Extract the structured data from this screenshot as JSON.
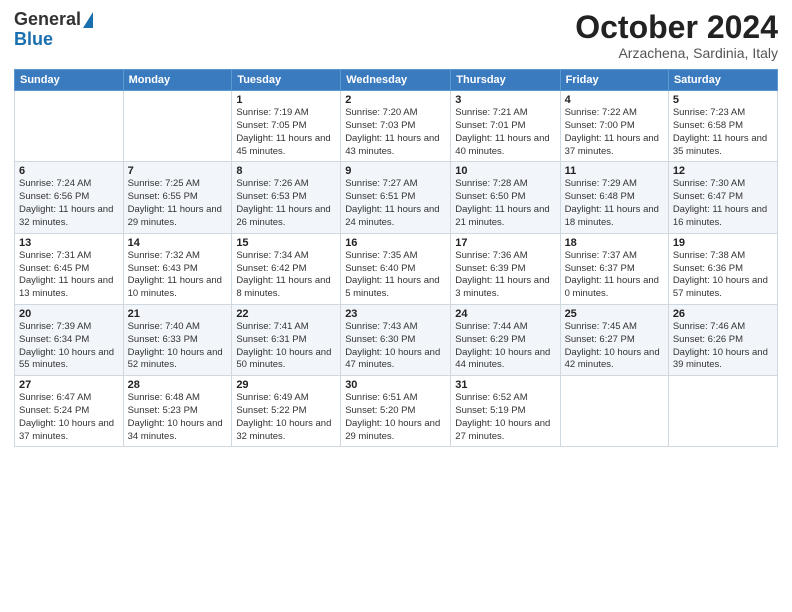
{
  "logo": {
    "line1": "General",
    "line2": "Blue"
  },
  "header": {
    "title": "October 2024",
    "subtitle": "Arzachena, Sardinia, Italy"
  },
  "weekdays": [
    "Sunday",
    "Monday",
    "Tuesday",
    "Wednesday",
    "Thursday",
    "Friday",
    "Saturday"
  ],
  "weeks": [
    [
      {
        "day": "",
        "info": ""
      },
      {
        "day": "",
        "info": ""
      },
      {
        "day": "1",
        "info": "Sunrise: 7:19 AM\nSunset: 7:05 PM\nDaylight: 11 hours and 45 minutes."
      },
      {
        "day": "2",
        "info": "Sunrise: 7:20 AM\nSunset: 7:03 PM\nDaylight: 11 hours and 43 minutes."
      },
      {
        "day": "3",
        "info": "Sunrise: 7:21 AM\nSunset: 7:01 PM\nDaylight: 11 hours and 40 minutes."
      },
      {
        "day": "4",
        "info": "Sunrise: 7:22 AM\nSunset: 7:00 PM\nDaylight: 11 hours and 37 minutes."
      },
      {
        "day": "5",
        "info": "Sunrise: 7:23 AM\nSunset: 6:58 PM\nDaylight: 11 hours and 35 minutes."
      }
    ],
    [
      {
        "day": "6",
        "info": "Sunrise: 7:24 AM\nSunset: 6:56 PM\nDaylight: 11 hours and 32 minutes."
      },
      {
        "day": "7",
        "info": "Sunrise: 7:25 AM\nSunset: 6:55 PM\nDaylight: 11 hours and 29 minutes."
      },
      {
        "day": "8",
        "info": "Sunrise: 7:26 AM\nSunset: 6:53 PM\nDaylight: 11 hours and 26 minutes."
      },
      {
        "day": "9",
        "info": "Sunrise: 7:27 AM\nSunset: 6:51 PM\nDaylight: 11 hours and 24 minutes."
      },
      {
        "day": "10",
        "info": "Sunrise: 7:28 AM\nSunset: 6:50 PM\nDaylight: 11 hours and 21 minutes."
      },
      {
        "day": "11",
        "info": "Sunrise: 7:29 AM\nSunset: 6:48 PM\nDaylight: 11 hours and 18 minutes."
      },
      {
        "day": "12",
        "info": "Sunrise: 7:30 AM\nSunset: 6:47 PM\nDaylight: 11 hours and 16 minutes."
      }
    ],
    [
      {
        "day": "13",
        "info": "Sunrise: 7:31 AM\nSunset: 6:45 PM\nDaylight: 11 hours and 13 minutes."
      },
      {
        "day": "14",
        "info": "Sunrise: 7:32 AM\nSunset: 6:43 PM\nDaylight: 11 hours and 10 minutes."
      },
      {
        "day": "15",
        "info": "Sunrise: 7:34 AM\nSunset: 6:42 PM\nDaylight: 11 hours and 8 minutes."
      },
      {
        "day": "16",
        "info": "Sunrise: 7:35 AM\nSunset: 6:40 PM\nDaylight: 11 hours and 5 minutes."
      },
      {
        "day": "17",
        "info": "Sunrise: 7:36 AM\nSunset: 6:39 PM\nDaylight: 11 hours and 3 minutes."
      },
      {
        "day": "18",
        "info": "Sunrise: 7:37 AM\nSunset: 6:37 PM\nDaylight: 11 hours and 0 minutes."
      },
      {
        "day": "19",
        "info": "Sunrise: 7:38 AM\nSunset: 6:36 PM\nDaylight: 10 hours and 57 minutes."
      }
    ],
    [
      {
        "day": "20",
        "info": "Sunrise: 7:39 AM\nSunset: 6:34 PM\nDaylight: 10 hours and 55 minutes."
      },
      {
        "day": "21",
        "info": "Sunrise: 7:40 AM\nSunset: 6:33 PM\nDaylight: 10 hours and 52 minutes."
      },
      {
        "day": "22",
        "info": "Sunrise: 7:41 AM\nSunset: 6:31 PM\nDaylight: 10 hours and 50 minutes."
      },
      {
        "day": "23",
        "info": "Sunrise: 7:43 AM\nSunset: 6:30 PM\nDaylight: 10 hours and 47 minutes."
      },
      {
        "day": "24",
        "info": "Sunrise: 7:44 AM\nSunset: 6:29 PM\nDaylight: 10 hours and 44 minutes."
      },
      {
        "day": "25",
        "info": "Sunrise: 7:45 AM\nSunset: 6:27 PM\nDaylight: 10 hours and 42 minutes."
      },
      {
        "day": "26",
        "info": "Sunrise: 7:46 AM\nSunset: 6:26 PM\nDaylight: 10 hours and 39 minutes."
      }
    ],
    [
      {
        "day": "27",
        "info": "Sunrise: 6:47 AM\nSunset: 5:24 PM\nDaylight: 10 hours and 37 minutes."
      },
      {
        "day": "28",
        "info": "Sunrise: 6:48 AM\nSunset: 5:23 PM\nDaylight: 10 hours and 34 minutes."
      },
      {
        "day": "29",
        "info": "Sunrise: 6:49 AM\nSunset: 5:22 PM\nDaylight: 10 hours and 32 minutes."
      },
      {
        "day": "30",
        "info": "Sunrise: 6:51 AM\nSunset: 5:20 PM\nDaylight: 10 hours and 29 minutes."
      },
      {
        "day": "31",
        "info": "Sunrise: 6:52 AM\nSunset: 5:19 PM\nDaylight: 10 hours and 27 minutes."
      },
      {
        "day": "",
        "info": ""
      },
      {
        "day": "",
        "info": ""
      }
    ]
  ]
}
